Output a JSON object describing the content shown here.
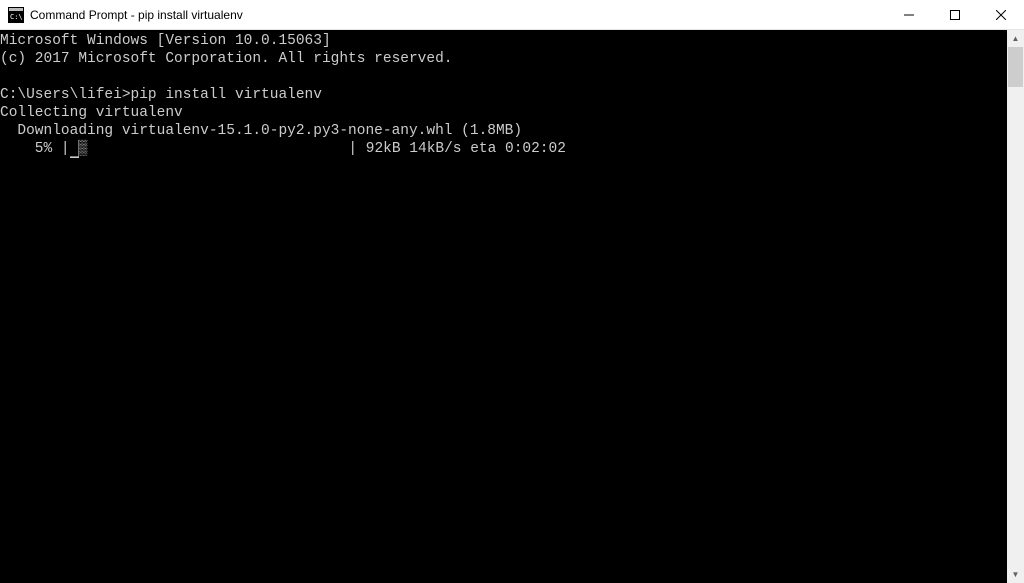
{
  "window": {
    "title": "Command Prompt - pip  install virtualenv"
  },
  "terminal": {
    "line1": "Microsoft Windows [Version 10.0.15063]",
    "line2": "(c) 2017 Microsoft Corporation. All rights reserved.",
    "blank1": "",
    "prompt": "C:\\Users\\lifei>",
    "command": "pip install virtualenv",
    "collecting": "Collecting virtualenv",
    "downloading": "  Downloading virtualenv-15.1.0-py2.py3-none-any.whl (1.8MB)",
    "progress_percent": "    5% ",
    "progress_bar_start": "|",
    "progress_filled": "█",
    "progress_replace": "▒",
    "progress_empty": "                              ",
    "progress_bar_end": "|",
    "progress_stats": " 92kB 14kB/s eta 0:02:02"
  }
}
